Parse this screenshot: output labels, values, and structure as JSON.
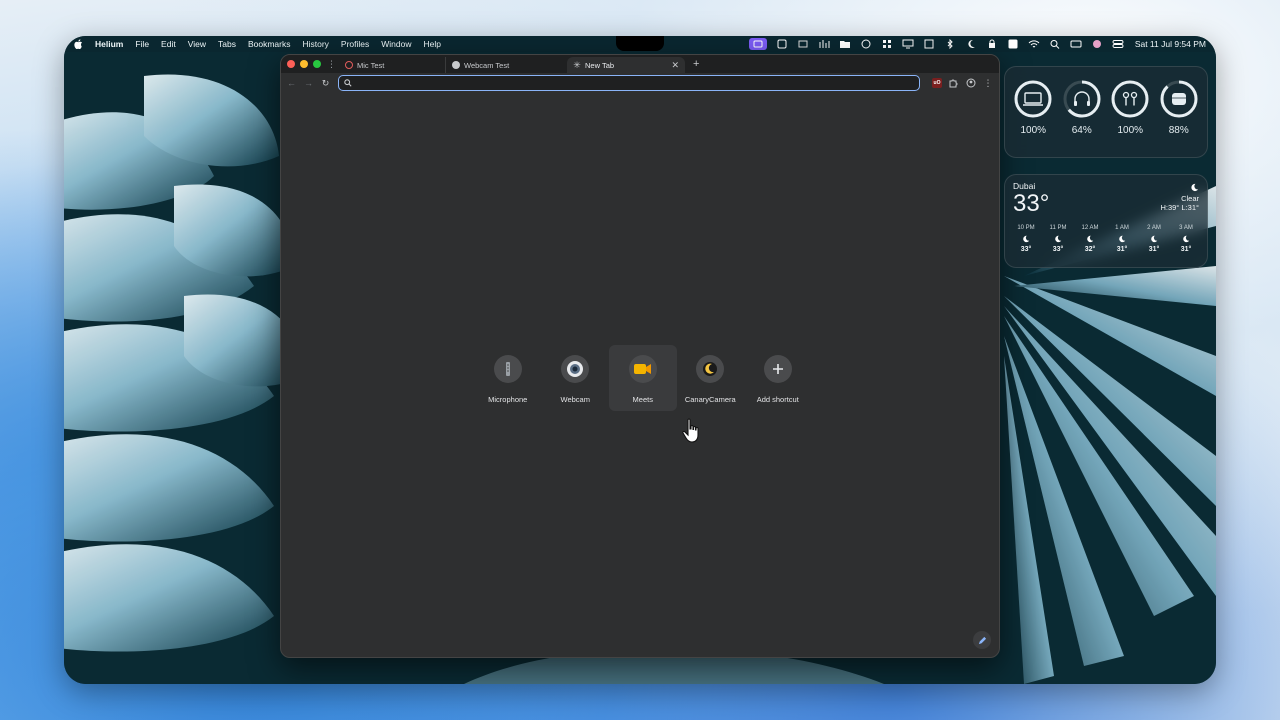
{
  "menubar": {
    "app_name": "Helium",
    "items": [
      "File",
      "Edit",
      "View",
      "Tabs",
      "Bookmarks",
      "History",
      "Profiles",
      "Window",
      "Help"
    ],
    "datetime": "Sat 11 Jul  9:54 PM"
  },
  "browser": {
    "tabs": [
      {
        "title": "Mic Test",
        "icon": "mic-test-favicon"
      },
      {
        "title": "Webcam Test",
        "icon": "webcam-test-favicon"
      },
      {
        "title": "New Tab",
        "icon": "new-tab-favicon",
        "active": true
      }
    ],
    "omnibox": {
      "value": ""
    },
    "extensions": {
      "ublock_label": "uO"
    }
  },
  "shortcuts": [
    {
      "label": "Microphone",
      "icon": "microphone-icon"
    },
    {
      "label": "Webcam",
      "icon": "webcam-icon"
    },
    {
      "label": "Meets",
      "icon": "meets-icon",
      "color": "#f4b400"
    },
    {
      "label": "CanaryCamera",
      "icon": "canary-camera-icon"
    },
    {
      "label": "Add shortcut",
      "icon": "plus-icon"
    }
  ],
  "batteries": [
    {
      "device": "laptop",
      "percent": "100%",
      "level": 1.0
    },
    {
      "device": "headphones",
      "percent": "64%",
      "level": 0.64
    },
    {
      "device": "airpods",
      "percent": "100%",
      "level": 1.0
    },
    {
      "device": "case",
      "percent": "88%",
      "level": 0.88
    }
  ],
  "weather": {
    "city": "Dubai",
    "temp": "33°",
    "condition": "Clear",
    "hilo": "H:39° L:31°",
    "hours": [
      {
        "time": "10 PM",
        "temp": "33°"
      },
      {
        "time": "11 PM",
        "temp": "33°"
      },
      {
        "time": "12 AM",
        "temp": "32°"
      },
      {
        "time": "1 AM",
        "temp": "31°"
      },
      {
        "time": "2 AM",
        "temp": "31°"
      },
      {
        "time": "3 AM",
        "temp": "31°"
      }
    ]
  },
  "colors": {
    "accent": "#8ab4f8",
    "ring": "#e6eef2"
  }
}
